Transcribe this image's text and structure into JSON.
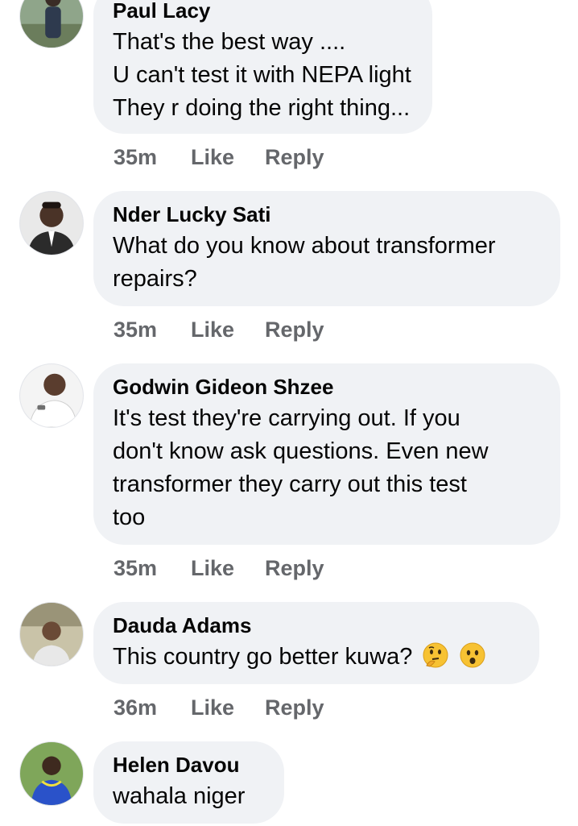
{
  "comments": [
    {
      "author": "Paul Lacy",
      "lines": [
        "That's the best way ....",
        "U can't test it with NEPA light",
        "They r doing the right thing..."
      ],
      "time": "35m",
      "like_label": "Like",
      "reply_label": "Reply"
    },
    {
      "author": "Nder Lucky Sati",
      "lines": [
        "What do you know about transformer",
        "repairs?"
      ],
      "time": "35m",
      "like_label": "Like",
      "reply_label": "Reply"
    },
    {
      "author": "Godwin Gideon Shzee",
      "lines": [
        "It's test they're carrying out. If you",
        "don't know ask questions. Even new",
        "transformer they carry out this test",
        "too"
      ],
      "time": "35m",
      "like_label": "Like",
      "reply_label": "Reply"
    },
    {
      "author": "Dauda Adams",
      "lines": [
        "This country go better kuwa?"
      ],
      "emojis": [
        "thinking-face",
        "astonished-face"
      ],
      "time": "36m",
      "like_label": "Like",
      "reply_label": "Reply"
    },
    {
      "author": "Helen Davou",
      "lines": [
        "wahala niger"
      ]
    }
  ],
  "colors": {
    "bubble": "#f0f2f5",
    "meta": "#65676b",
    "text": "#050505"
  }
}
